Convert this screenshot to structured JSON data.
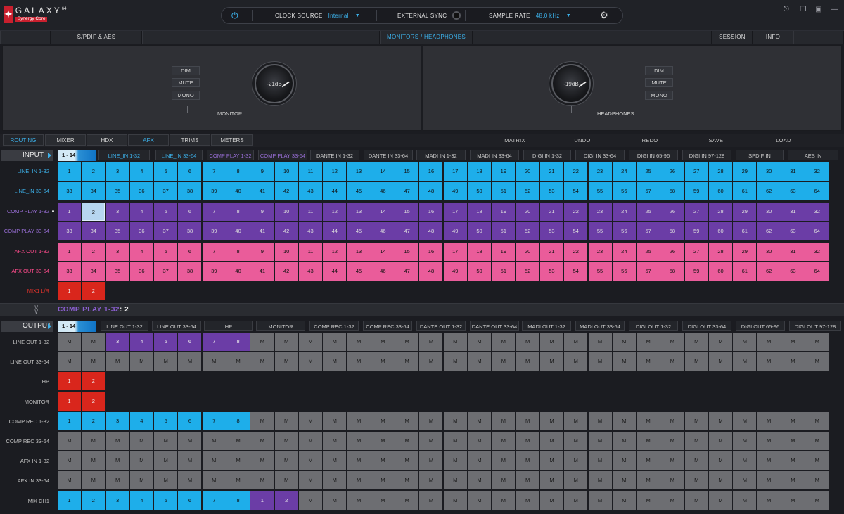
{
  "logo": {
    "brand": "GALAXY",
    "superscript": "64",
    "sub": "Synergy Core"
  },
  "top": {
    "clock_label": "CLOCK SOURCE",
    "clock_value": "Internal",
    "sync_label": "EXTERNAL SYNC",
    "rate_label": "SAMPLE RATE",
    "rate_value": "48.0 kHz"
  },
  "nav": {
    "tabs": [
      "S/PDIF & AES",
      "MONITORS / HEADPHONES",
      "SESSION",
      "INFO"
    ],
    "active": 1
  },
  "monitor": {
    "buttons": [
      "DIM",
      "MUTE",
      "MONO"
    ],
    "knob": "-21dB",
    "label": "MONITOR"
  },
  "headphones": {
    "buttons": [
      "DIM",
      "MUTE",
      "MONO"
    ],
    "knob": "-19dB",
    "label": "HEADPHONES"
  },
  "func": {
    "tabs": [
      "ROUTING",
      "MIXER",
      "HDX",
      "AFX",
      "TRIMS",
      "METERS"
    ],
    "actions": [
      "MATRIX",
      "UNDO",
      "REDO",
      "SAVE",
      "LOAD"
    ]
  },
  "input": {
    "title": "INPUT",
    "range": "1 - 14",
    "tabs": [
      "LINE_IN 1-32",
      "LINE_IN 33-64",
      "COMP PLAY 1-32",
      "COMP PLAY 33-64",
      "DANTE IN 1-32",
      "DANTE IN 33-64",
      "MADI IN 1-32",
      "MADI IN 33-64",
      "DIGI IN 1-32",
      "DIGI IN 33-64",
      "DIGI IN 65-96",
      "DIGI IN 97-128",
      "SPDIF IN",
      "AES IN"
    ],
    "rows": [
      {
        "label": "LINE_IN 1-32",
        "start": 1,
        "count": 32
      },
      {
        "label": "LINE_IN 33-64",
        "start": 33,
        "count": 32
      },
      {
        "label": "COMP PLAY 1-32",
        "start": 1,
        "count": 32
      },
      {
        "label": "COMP PLAY 33-64",
        "start": 33,
        "count": 32
      },
      {
        "label": "AFX OUT 1-32",
        "start": 1,
        "count": 32
      },
      {
        "label": "AFX OUT 33-64",
        "start": 33,
        "count": 32
      },
      {
        "label": "MIX1 L/R",
        "start": 1,
        "count": 2
      }
    ]
  },
  "selection": {
    "name": "COMP PLAY 1-32",
    "sep": ":",
    "channel": "2"
  },
  "output": {
    "title": "OUTPUT",
    "range": "1 - 14",
    "tabs": [
      "LINE OUT 1-32",
      "LINE OUT 33-64",
      "HP",
      "MONITOR",
      "COMP REC 1-32",
      "COMP REC 33-64",
      "DANTE OUT 1-32",
      "DANTE OUT 33-64",
      "MADI OUT 1-32",
      "MADI OUT 33-64",
      "DIGI OUT 1-32",
      "DIGI OUT 33-64",
      "DIGI OUT 65-96",
      "DIGI OUT 97-128"
    ],
    "mute": "M",
    "rows": [
      {
        "label": "LINE OUT 1-32",
        "count": 32,
        "assigned": [
          [
            2,
            "3"
          ],
          [
            3,
            "4"
          ],
          [
            4,
            "5"
          ],
          [
            5,
            "6"
          ],
          [
            6,
            "7"
          ],
          [
            7,
            "8"
          ]
        ],
        "assignedColor": "purple"
      },
      {
        "label": "LINE OUT 33-64",
        "count": 32,
        "assigned": []
      },
      {
        "label": "HP",
        "count": 2,
        "assigned": [
          [
            0,
            "1"
          ],
          [
            1,
            "2"
          ]
        ],
        "assignedColor": "red"
      },
      {
        "label": "MONITOR",
        "count": 2,
        "assigned": [
          [
            0,
            "1"
          ],
          [
            1,
            "2"
          ]
        ],
        "assignedColor": "red"
      },
      {
        "label": "COMP REC 1-32",
        "count": 32,
        "assigned": [
          [
            0,
            "1"
          ],
          [
            1,
            "2"
          ],
          [
            2,
            "3"
          ],
          [
            3,
            "4"
          ],
          [
            4,
            "5"
          ],
          [
            5,
            "6"
          ],
          [
            6,
            "7"
          ],
          [
            7,
            "8"
          ]
        ],
        "assignedColor": "blue"
      },
      {
        "label": "COMP REC 33-64",
        "count": 32,
        "assigned": []
      },
      {
        "label": "AFX IN 1-32",
        "count": 32,
        "assigned": []
      },
      {
        "label": "AFX IN 33-64",
        "count": 32,
        "assigned": []
      },
      {
        "label": "MIX CH1",
        "count": 32,
        "assigned": [
          [
            0,
            "1"
          ],
          [
            1,
            "2"
          ],
          [
            2,
            "3"
          ],
          [
            3,
            "4"
          ],
          [
            4,
            "5"
          ],
          [
            5,
            "6"
          ],
          [
            6,
            "7"
          ],
          [
            7,
            "8"
          ],
          [
            8,
            "1"
          ],
          [
            9,
            "2"
          ]
        ],
        "assignedColor": "blue",
        "purpleFrom": 8
      }
    ]
  },
  "colors": {
    "accent": "#3cb1ea",
    "blue": "#1eaeea",
    "purple": "#6b3da6",
    "pink": "#ea5c9a",
    "red": "#d9261c",
    "grey": "#6d6e72"
  }
}
